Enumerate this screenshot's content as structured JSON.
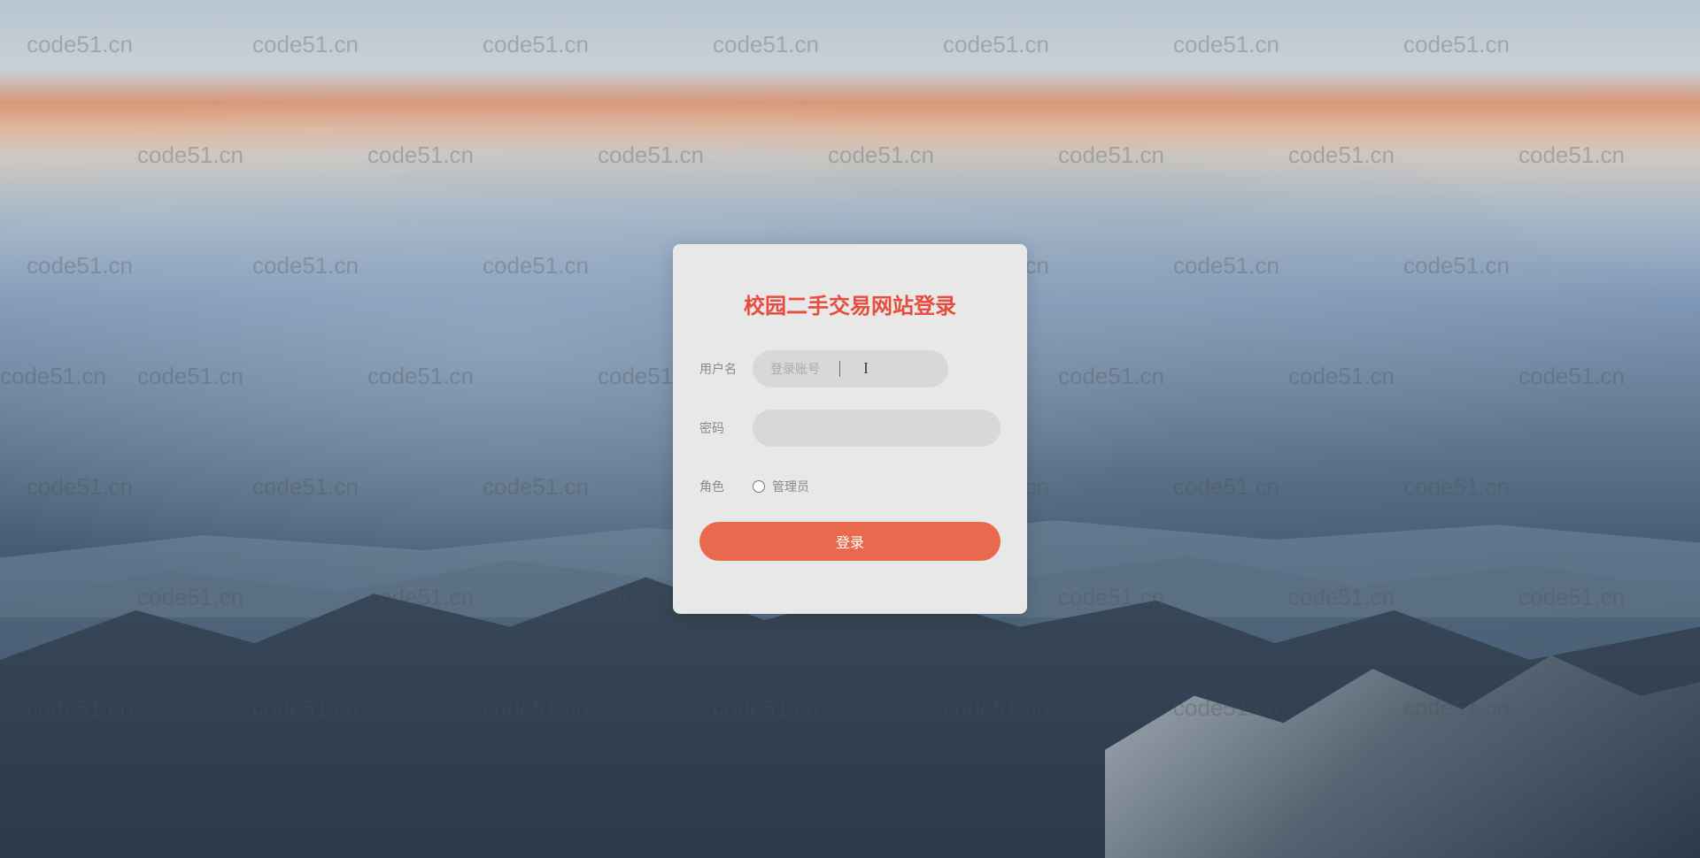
{
  "watermark_text": "code51.cn",
  "login": {
    "title": "校园二手交易网站登录",
    "username_label": "用户名",
    "username_placeholder": "登录账号",
    "username_value": "",
    "password_label": "密码",
    "password_value": "",
    "role_label": "角色",
    "role_option_admin": "管理员",
    "submit_button": "登录"
  },
  "colors": {
    "accent": "#e74c3c",
    "button": "#e8694e",
    "card_bg": "#e8e8e8",
    "input_bg": "#d8d8d8",
    "label_text": "#888"
  }
}
